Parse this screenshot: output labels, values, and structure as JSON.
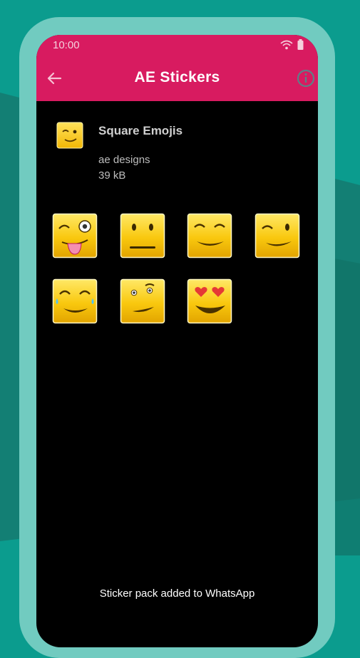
{
  "status_bar": {
    "time": "10:00",
    "wifi_icon": "wifi-icon",
    "battery_icon": "battery-icon"
  },
  "app_bar": {
    "title": "AE Stickers",
    "back_icon": "arrow-left-icon",
    "info_icon": "info-icon"
  },
  "pack": {
    "name": "Square Emojis",
    "publisher": "ae designs",
    "size": "39 kB"
  },
  "stickers": [
    {
      "name": "wink-tongue-emoji"
    },
    {
      "name": "neutral-face-emoji"
    },
    {
      "name": "content-smile-emoji"
    },
    {
      "name": "wink-smile-emoji"
    },
    {
      "name": "tears-of-joy-emoji"
    },
    {
      "name": "raised-eyebrow-emoji"
    },
    {
      "name": "heart-eyes-emoji"
    }
  ],
  "toast": "Sticker pack added to WhatsApp",
  "colors": {
    "app_bar": "#d81b60",
    "background": "#0b9c8e",
    "phone_frame": "#71cbc0",
    "screen": "#000000"
  }
}
